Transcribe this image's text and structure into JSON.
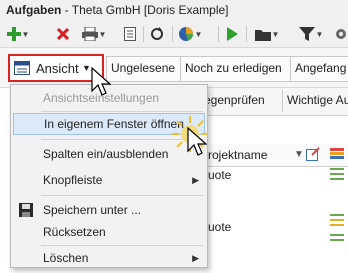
{
  "window": {
    "title_bold": "Aufgaben",
    "title_rest": " - Theta GmbH [Doris Example]"
  },
  "toolbar": {
    "icons": [
      "add-icon",
      "delete-icon",
      "print-icon",
      "document-icon",
      "refresh-icon",
      "pie-chart-icon",
      "run-icon",
      "folder-icon",
      "filter-icon",
      "settings-icon"
    ],
    "colors": {
      "add": "#2e9b2e",
      "delete": "#d42020",
      "run": "#2ea02e"
    }
  },
  "view_strip": {
    "view_label": "Ansicht",
    "buttons": [
      "Ungelesene",
      "Noch zu erledigen",
      "Angefang"
    ]
  },
  "strip2": {
    "buttons": [
      "egenprüfen",
      "Wichtige Au"
    ]
  },
  "grid": {
    "header": {
      "col": "rojektname"
    },
    "rows": [
      "uote",
      "uote"
    ]
  },
  "menu": {
    "items": [
      {
        "label": "Ansichtseinstellungen",
        "disabled": true
      },
      {
        "label": "In eigenem Fenster öffnen",
        "highlighted": true
      },
      {
        "label": "Spalten ein/ausblenden"
      },
      {
        "label": "Knopfleiste",
        "submenu": true
      },
      {
        "label": "Speichern unter ...",
        "icon": "save-icon"
      },
      {
        "label": "Rücksetzen"
      },
      {
        "label": "Löschen",
        "submenu": true
      }
    ]
  },
  "accent": {
    "highlight_border": "#d22222",
    "menu_highlight": "#dbe9f8"
  }
}
